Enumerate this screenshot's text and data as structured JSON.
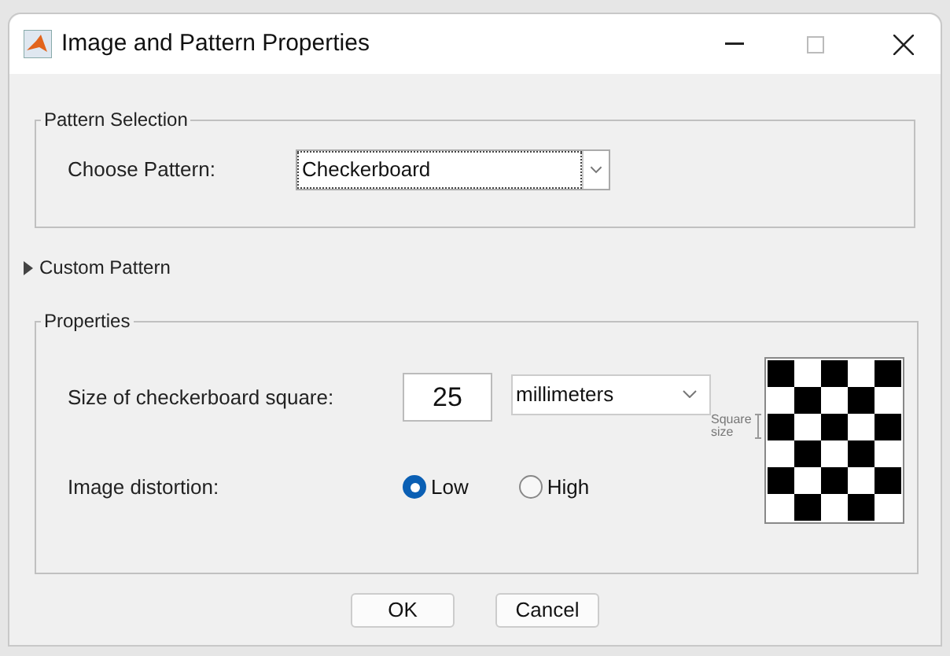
{
  "window": {
    "title": "Image and Pattern Properties"
  },
  "pattern_selection": {
    "title": "Pattern Selection",
    "label": "Choose Pattern:",
    "value": "Checkerboard"
  },
  "custom_pattern": {
    "label": "Custom Pattern",
    "expanded": false
  },
  "properties": {
    "title": "Properties",
    "size_label": "Size of checkerboard square:",
    "size_value": "25",
    "units": "millimeters",
    "distortion_label": "Image distortion:",
    "distortion_options": [
      {
        "label": "Low",
        "selected": true
      },
      {
        "label": "High",
        "selected": false
      }
    ],
    "preview_label": "Square size"
  },
  "buttons": [
    "OK",
    "Cancel"
  ]
}
